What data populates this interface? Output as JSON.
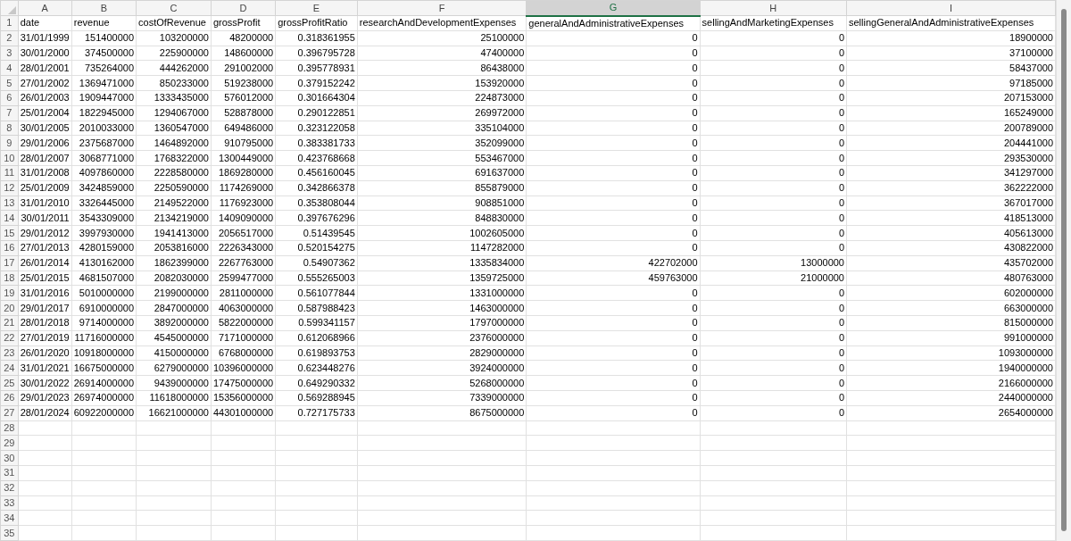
{
  "columns": [
    {
      "letter": "A",
      "selected": false
    },
    {
      "letter": "B",
      "selected": false
    },
    {
      "letter": "C",
      "selected": false
    },
    {
      "letter": "D",
      "selected": false
    },
    {
      "letter": "E",
      "selected": false
    },
    {
      "letter": "F",
      "selected": false
    },
    {
      "letter": "G",
      "selected": true
    },
    {
      "letter": "H",
      "selected": false
    },
    {
      "letter": "I",
      "selected": false
    }
  ],
  "rows": [
    {
      "number": "1",
      "kind": "header",
      "cells": [
        "date",
        "revenue",
        "costOfRevenue",
        "grossProfit",
        "grossProfitRatio",
        "researchAndDevelopmentExpenses",
        "generalAndAdministrativeExpenses",
        "sellingAndMarketingExpenses",
        "sellingGeneralAndAdministrativeExpenses"
      ]
    },
    {
      "number": "2",
      "kind": "data",
      "cells": [
        "31/01/1999",
        "151400000",
        "103200000",
        "48200000",
        "0.318361955",
        "25100000",
        "0",
        "0",
        "18900000"
      ]
    },
    {
      "number": "3",
      "kind": "data",
      "cells": [
        "30/01/2000",
        "374500000",
        "225900000",
        "148600000",
        "0.396795728",
        "47400000",
        "0",
        "0",
        "37100000"
      ]
    },
    {
      "number": "4",
      "kind": "data",
      "cells": [
        "28/01/2001",
        "735264000",
        "444262000",
        "291002000",
        "0.395778931",
        "86438000",
        "0",
        "0",
        "58437000"
      ]
    },
    {
      "number": "5",
      "kind": "data",
      "cells": [
        "27/01/2002",
        "1369471000",
        "850233000",
        "519238000",
        "0.379152242",
        "153920000",
        "0",
        "0",
        "97185000"
      ]
    },
    {
      "number": "6",
      "kind": "data",
      "cells": [
        "26/01/2003",
        "1909447000",
        "1333435000",
        "576012000",
        "0.301664304",
        "224873000",
        "0",
        "0",
        "207153000"
      ]
    },
    {
      "number": "7",
      "kind": "data",
      "cells": [
        "25/01/2004",
        "1822945000",
        "1294067000",
        "528878000",
        "0.290122851",
        "269972000",
        "0",
        "0",
        "165249000"
      ]
    },
    {
      "number": "8",
      "kind": "data",
      "cells": [
        "30/01/2005",
        "2010033000",
        "1360547000",
        "649486000",
        "0.323122058",
        "335104000",
        "0",
        "0",
        "200789000"
      ]
    },
    {
      "number": "9",
      "kind": "data",
      "cells": [
        "29/01/2006",
        "2375687000",
        "1464892000",
        "910795000",
        "0.383381733",
        "352099000",
        "0",
        "0",
        "204441000"
      ]
    },
    {
      "number": "10",
      "kind": "data",
      "cells": [
        "28/01/2007",
        "3068771000",
        "1768322000",
        "1300449000",
        "0.423768668",
        "553467000",
        "0",
        "0",
        "293530000"
      ]
    },
    {
      "number": "11",
      "kind": "data",
      "cells": [
        "31/01/2008",
        "4097860000",
        "2228580000",
        "1869280000",
        "0.456160045",
        "691637000",
        "0",
        "0",
        "341297000"
      ]
    },
    {
      "number": "12",
      "kind": "data",
      "cells": [
        "25/01/2009",
        "3424859000",
        "2250590000",
        "1174269000",
        "0.342866378",
        "855879000",
        "0",
        "0",
        "362222000"
      ]
    },
    {
      "number": "13",
      "kind": "data",
      "cells": [
        "31/01/2010",
        "3326445000",
        "2149522000",
        "1176923000",
        "0.353808044",
        "908851000",
        "0",
        "0",
        "367017000"
      ]
    },
    {
      "number": "14",
      "kind": "data",
      "cells": [
        "30/01/2011",
        "3543309000",
        "2134219000",
        "1409090000",
        "0.397676296",
        "848830000",
        "0",
        "0",
        "418513000"
      ]
    },
    {
      "number": "15",
      "kind": "data",
      "cells": [
        "29/01/2012",
        "3997930000",
        "1941413000",
        "2056517000",
        "0.51439545",
        "1002605000",
        "0",
        "0",
        "405613000"
      ]
    },
    {
      "number": "16",
      "kind": "data",
      "cells": [
        "27/01/2013",
        "4280159000",
        "2053816000",
        "2226343000",
        "0.520154275",
        "1147282000",
        "0",
        "0",
        "430822000"
      ]
    },
    {
      "number": "17",
      "kind": "data",
      "cells": [
        "26/01/2014",
        "4130162000",
        "1862399000",
        "2267763000",
        "0.54907362",
        "1335834000",
        "422702000",
        "13000000",
        "435702000"
      ]
    },
    {
      "number": "18",
      "kind": "data",
      "cells": [
        "25/01/2015",
        "4681507000",
        "2082030000",
        "2599477000",
        "0.555265003",
        "1359725000",
        "459763000",
        "21000000",
        "480763000"
      ]
    },
    {
      "number": "19",
      "kind": "data",
      "cells": [
        "31/01/2016",
        "5010000000",
        "2199000000",
        "2811000000",
        "0.561077844",
        "1331000000",
        "0",
        "0",
        "602000000"
      ]
    },
    {
      "number": "20",
      "kind": "data",
      "cells": [
        "29/01/2017",
        "6910000000",
        "2847000000",
        "4063000000",
        "0.587988423",
        "1463000000",
        "0",
        "0",
        "663000000"
      ]
    },
    {
      "number": "21",
      "kind": "data",
      "cells": [
        "28/01/2018",
        "9714000000",
        "3892000000",
        "5822000000",
        "0.599341157",
        "1797000000",
        "0",
        "0",
        "815000000"
      ]
    },
    {
      "number": "22",
      "kind": "data",
      "cells": [
        "27/01/2019",
        "11716000000",
        "4545000000",
        "7171000000",
        "0.612068966",
        "2376000000",
        "0",
        "0",
        "991000000"
      ]
    },
    {
      "number": "23",
      "kind": "data",
      "cells": [
        "26/01/2020",
        "10918000000",
        "4150000000",
        "6768000000",
        "0.619893753",
        "2829000000",
        "0",
        "0",
        "1093000000"
      ]
    },
    {
      "number": "24",
      "kind": "data",
      "cells": [
        "31/01/2021",
        "16675000000",
        "6279000000",
        "10396000000",
        "0.623448276",
        "3924000000",
        "0",
        "0",
        "1940000000"
      ]
    },
    {
      "number": "25",
      "kind": "data",
      "cells": [
        "30/01/2022",
        "26914000000",
        "9439000000",
        "17475000000",
        "0.649290332",
        "5268000000",
        "0",
        "0",
        "2166000000"
      ]
    },
    {
      "number": "26",
      "kind": "data",
      "cells": [
        "29/01/2023",
        "26974000000",
        "11618000000",
        "15356000000",
        "0.569288945",
        "7339000000",
        "0",
        "0",
        "2440000000"
      ]
    },
    {
      "number": "27",
      "kind": "data",
      "cells": [
        "28/01/2024",
        "60922000000",
        "16621000000",
        "44301000000",
        "0.727175733",
        "8675000000",
        "0",
        "0",
        "2654000000"
      ]
    },
    {
      "number": "28",
      "kind": "data"
    },
    {
      "number": "29",
      "kind": "data"
    },
    {
      "number": "30",
      "kind": "data"
    },
    {
      "number": "31",
      "kind": "data"
    },
    {
      "number": "32",
      "kind": "data"
    },
    {
      "number": "33",
      "kind": "data"
    },
    {
      "number": "34",
      "kind": "data"
    },
    {
      "number": "35",
      "kind": "data"
    }
  ]
}
